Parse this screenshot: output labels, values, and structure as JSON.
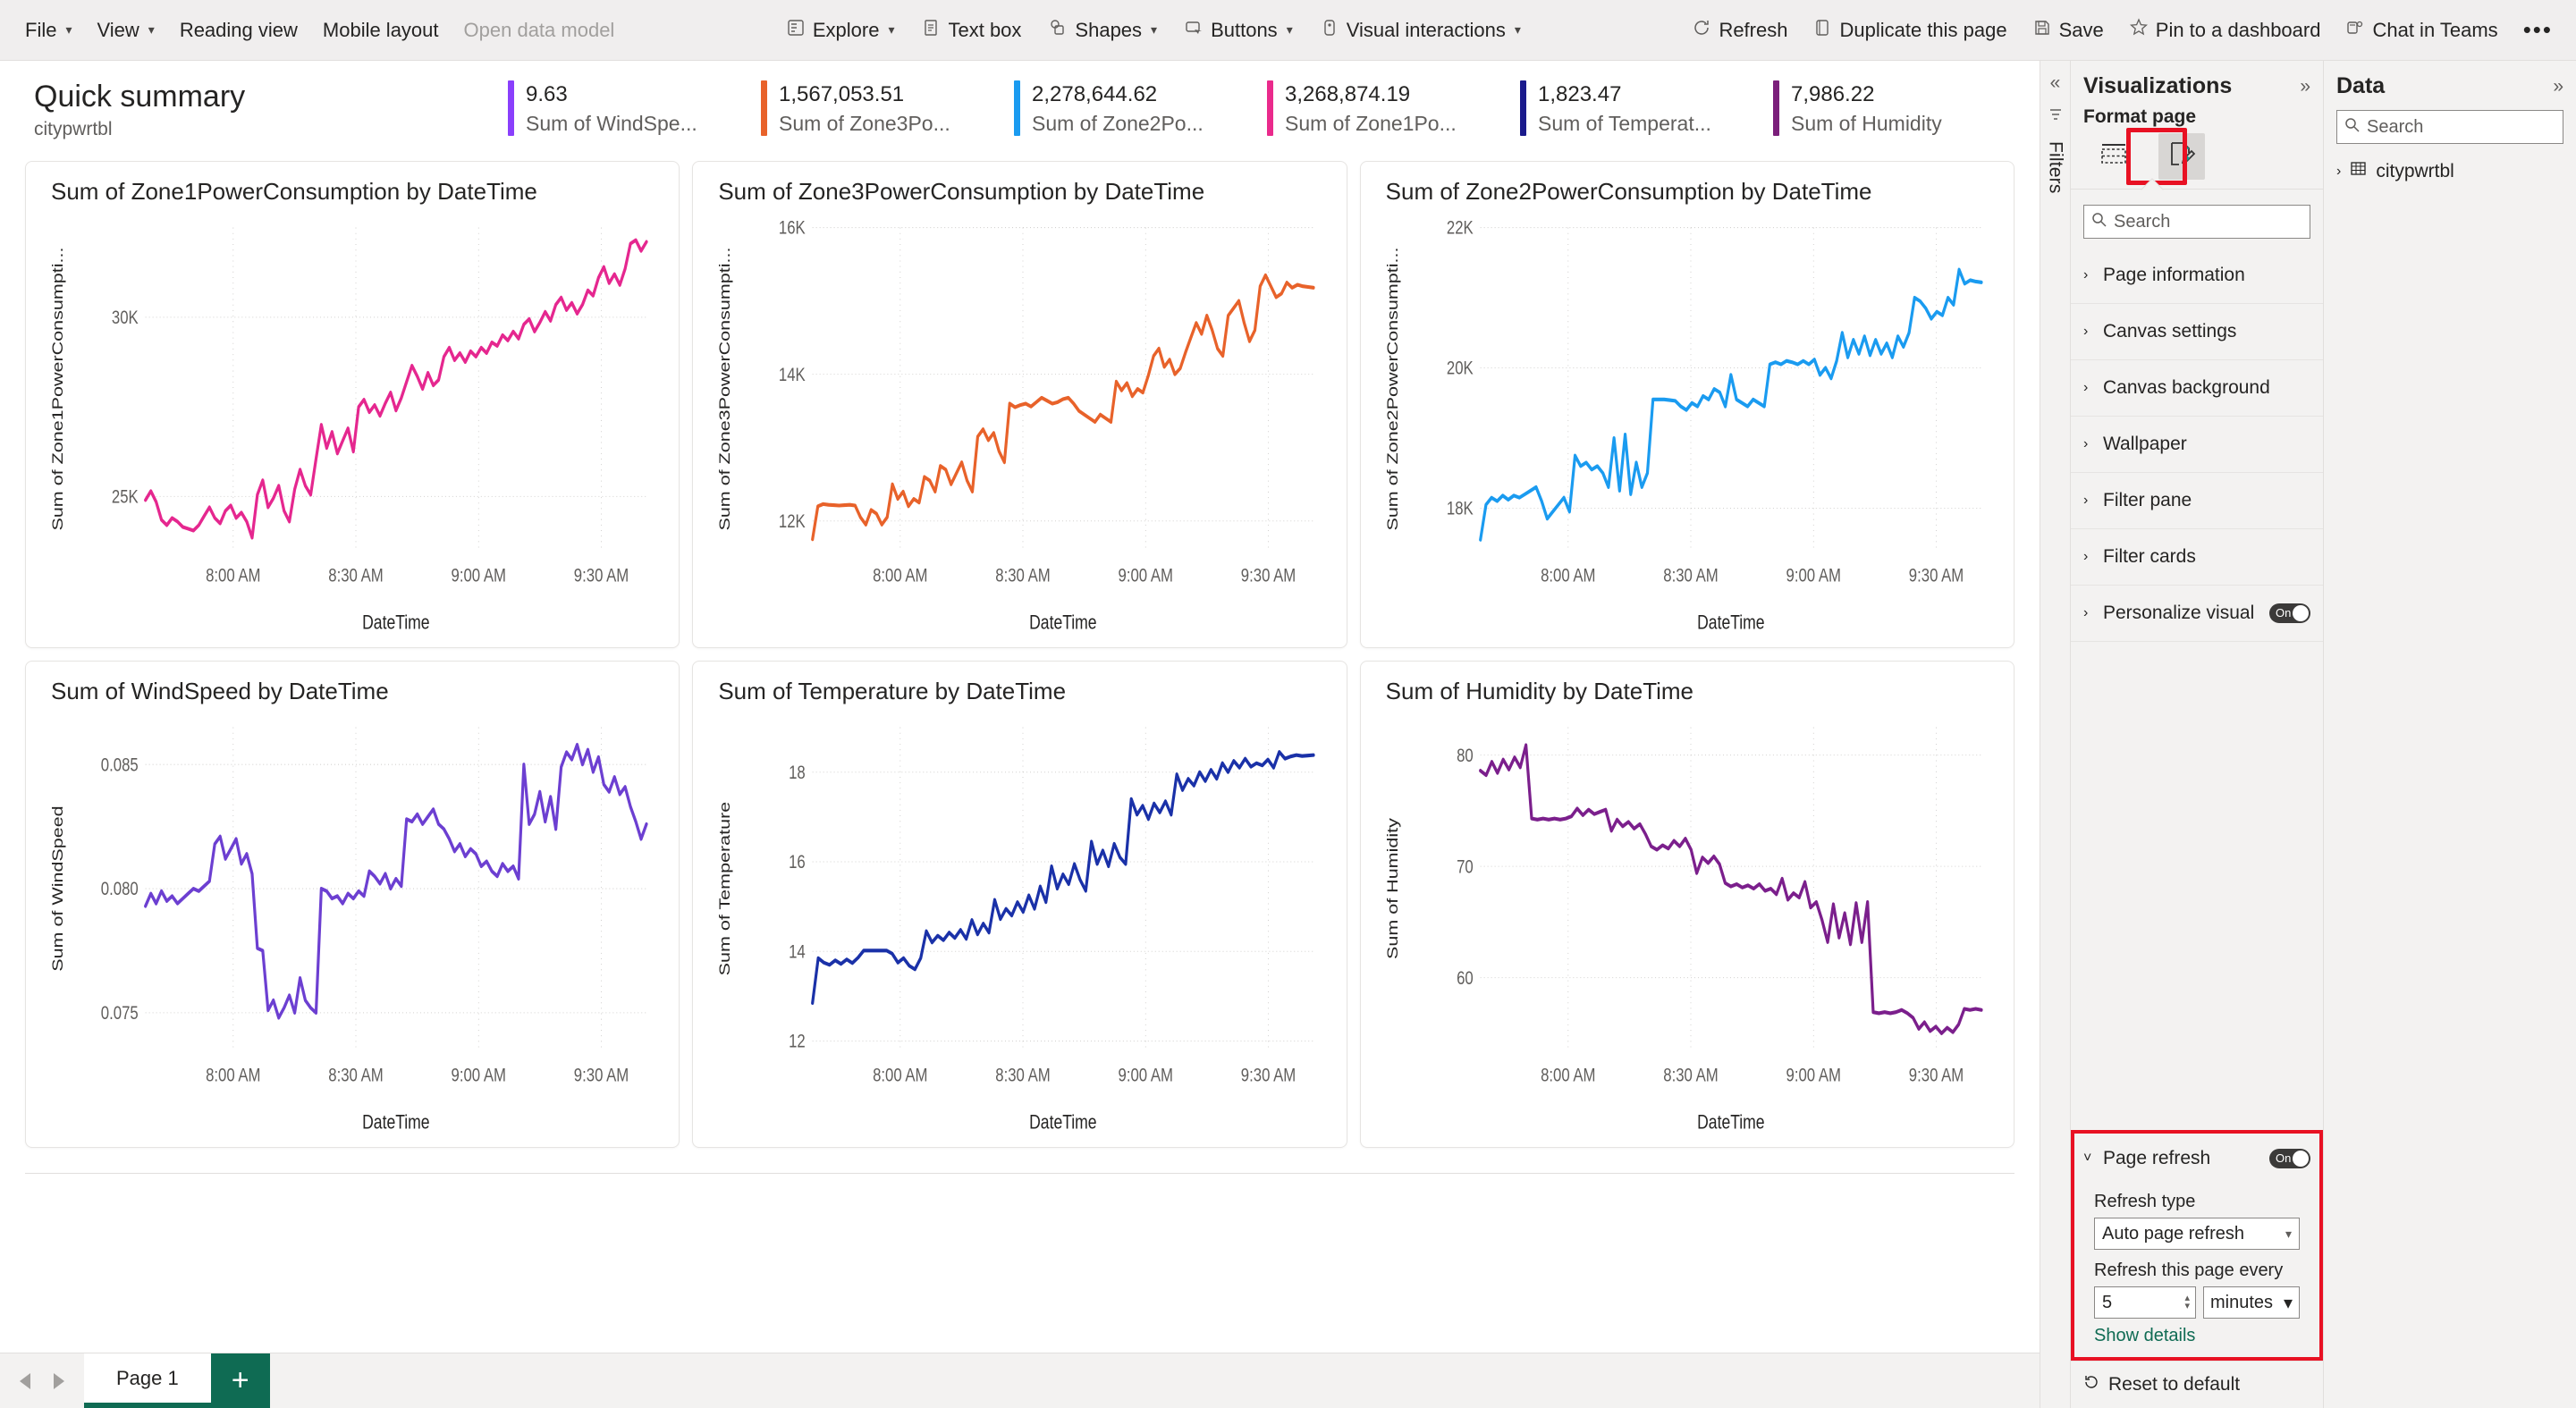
{
  "ribbon": {
    "left": [
      {
        "label": "File",
        "icon": "chevron-down-icon",
        "has_chevron": true,
        "dim": false
      },
      {
        "label": "View",
        "icon": "chevron-down-icon",
        "has_chevron": true,
        "dim": false
      },
      {
        "label": "Reading view",
        "icon": "",
        "has_chevron": false,
        "dim": false
      },
      {
        "label": "Mobile layout",
        "icon": "",
        "has_chevron": false,
        "dim": false
      },
      {
        "label": "Open data model",
        "icon": "",
        "has_chevron": false,
        "dim": true
      }
    ],
    "center": [
      {
        "label": "Explore",
        "icon": "explore-icon",
        "has_chevron": true
      },
      {
        "label": "Text box",
        "icon": "textbox-icon",
        "has_chevron": false
      },
      {
        "label": "Shapes",
        "icon": "shapes-icon",
        "has_chevron": true
      },
      {
        "label": "Buttons",
        "icon": "buttons-icon",
        "has_chevron": true
      },
      {
        "label": "Visual interactions",
        "icon": "visual-interactions-icon",
        "has_chevron": true
      }
    ],
    "right": [
      {
        "label": "Refresh",
        "icon": "refresh-icon"
      },
      {
        "label": "Duplicate this page",
        "icon": "duplicate-icon"
      },
      {
        "label": "Save",
        "icon": "save-icon"
      },
      {
        "label": "Pin to a dashboard",
        "icon": "pin-icon"
      },
      {
        "label": "Chat in Teams",
        "icon": "teams-icon"
      }
    ],
    "overflow_label": "•••"
  },
  "summary": {
    "title": "Quick summary",
    "subtitle": "citypwrtbl",
    "kpis": [
      {
        "value": "9.63",
        "label": "Sum of WindSpe...",
        "color": "#8a3ffc"
      },
      {
        "value": "1,567,053.51",
        "label": "Sum of Zone3Po...",
        "color": "#e8622a"
      },
      {
        "value": "2,278,644.62",
        "label": "Sum of Zone2Po...",
        "color": "#1a9bf0"
      },
      {
        "value": "3,268,874.19",
        "label": "Sum of Zone1Po...",
        "color": "#ea2a8c"
      },
      {
        "value": "1,823.47",
        "label": "Sum of Temperat...",
        "color": "#1a1a8c"
      },
      {
        "value": "7,986.22",
        "label": "Sum of Humidity",
        "color": "#7b1f7b"
      }
    ]
  },
  "chart_data": [
    {
      "type": "line",
      "title": "Sum of Zone1PowerConsumption by DateTime",
      "xlabel": "DateTime",
      "ylabel": "Sum of Zone1PowerConsumpti...",
      "color": "#e5278f",
      "xticks": [
        "8:00 AM",
        "8:30 AM",
        "9:00 AM",
        "9:30 AM"
      ],
      "yticks": [
        "25K",
        "30K"
      ],
      "ytick_values": [
        25000,
        30000
      ],
      "ylim": [
        23500,
        32500
      ],
      "values": [
        24900,
        25150,
        24850,
        24350,
        24200,
        24400,
        24300,
        24150,
        24100,
        24050,
        24200,
        24450,
        24700,
        24400,
        24250,
        24600,
        24750,
        24400,
        24550,
        24300,
        23850,
        25050,
        25450,
        24700,
        24950,
        25300,
        24600,
        24300,
        25200,
        25750,
        25300,
        25050,
        26050,
        27000,
        26350,
        26800,
        26200,
        26550,
        26900,
        26250,
        27500,
        27700,
        27350,
        27550,
        27250,
        27600,
        27900,
        27400,
        27750,
        28200,
        28650,
        28350,
        28000,
        28450,
        28100,
        28250,
        28900,
        29150,
        28800,
        29000,
        28750,
        29050,
        28900,
        29150,
        29000,
        29300,
        29200,
        29500,
        29350,
        29600,
        29400,
        29800,
        29950,
        29600,
        29850,
        30150,
        29900,
        30350,
        30550,
        30200,
        30400,
        30100,
        30350,
        30750,
        30600,
        31100,
        31400,
        30950,
        31200,
        30900,
        31350,
        32050,
        32150,
        31850,
        32100
      ]
    },
    {
      "type": "line",
      "title": "Sum of Zone3PowerConsumption by DateTime",
      "xlabel": "DateTime",
      "ylabel": "Sum of Zone3PowerConsumpti...",
      "color": "#e8622a",
      "xticks": [
        "8:00 AM",
        "8:30 AM",
        "9:00 AM",
        "9:30 AM"
      ],
      "yticks": [
        "12K",
        "14K",
        "16K"
      ],
      "ytick_values": [
        12000,
        14000,
        16000
      ],
      "ylim": [
        11600,
        16000
      ],
      "values": [
        11750,
        12200,
        12230,
        12220,
        12215,
        12210,
        12215,
        12220,
        12210,
        12050,
        11950,
        12150,
        12100,
        11950,
        12050,
        12500,
        12300,
        12400,
        12200,
        12300,
        12250,
        12600,
        12550,
        12400,
        12750,
        12700,
        12500,
        12650,
        12800,
        12550,
        12400,
        13150,
        13250,
        13100,
        13200,
        12950,
        12800,
        13600,
        13550,
        13580,
        13600,
        13560,
        13620,
        13680,
        13640,
        13600,
        13620,
        13660,
        13680,
        13600,
        13500,
        13450,
        13400,
        13350,
        13450,
        13400,
        13350,
        13900,
        13780,
        13880,
        13700,
        13800,
        13750,
        13980,
        14250,
        14350,
        14100,
        14200,
        14000,
        14080,
        14300,
        14500,
        14700,
        14550,
        14800,
        14600,
        14350,
        14250,
        14800,
        14900,
        15000,
        14700,
        14450,
        14600,
        15200,
        15350,
        15200,
        15050,
        15100,
        15250,
        15180,
        15220,
        15200,
        15190,
        15180
      ]
    },
    {
      "type": "line",
      "title": "Sum of Zone2PowerConsumption by DateTime",
      "xlabel": "DateTime",
      "ylabel": "Sum of Zone2PowerConsumpti...",
      "color": "#1a9bf0",
      "xticks": [
        "8:00 AM",
        "8:30 AM",
        "9:00 AM",
        "9:30 AM"
      ],
      "yticks": [
        "18K",
        "20K",
        "22K"
      ],
      "ytick_values": [
        18000,
        20000,
        22000
      ],
      "ylim": [
        17400,
        22000
      ],
      "values": [
        17550,
        18050,
        18150,
        18100,
        18180,
        18120,
        18180,
        18150,
        18200,
        18250,
        18300,
        18100,
        17850,
        17950,
        18050,
        18150,
        17950,
        18750,
        18600,
        18650,
        18550,
        18600,
        18500,
        18300,
        19000,
        18250,
        19050,
        18200,
        18650,
        18300,
        18500,
        19550,
        19550,
        19550,
        19540,
        19530,
        19450,
        19400,
        19500,
        19450,
        19600,
        19550,
        19700,
        19650,
        19450,
        19900,
        19550,
        19500,
        19450,
        19550,
        19500,
        19450,
        20050,
        20080,
        20050,
        20100,
        20080,
        20050,
        20100,
        20050,
        20120,
        19900,
        20000,
        19850,
        20100,
        20500,
        20150,
        20400,
        20200,
        20450,
        20180,
        20400,
        20200,
        20350,
        20150,
        20450,
        20300,
        20500,
        21000,
        20950,
        20850,
        20700,
        20800,
        20750,
        21000,
        20900,
        21400,
        21200,
        21250,
        21230,
        21220
      ]
    },
    {
      "type": "line",
      "title": "Sum of WindSpeed by DateTime",
      "xlabel": "DateTime",
      "ylabel": "Sum of WindSpeed",
      "color": "#6c3fd1",
      "xticks": [
        "8:00 AM",
        "8:30 AM",
        "9:00 AM",
        "9:30 AM"
      ],
      "yticks": [
        "0.075",
        "0.080",
        "0.085"
      ],
      "ytick_values": [
        0.075,
        0.08,
        0.085
      ],
      "ylim": [
        0.0735,
        0.0865
      ],
      "values": [
        0.0793,
        0.0798,
        0.0794,
        0.0799,
        0.0795,
        0.0797,
        0.0794,
        0.0796,
        0.0798,
        0.08,
        0.0799,
        0.0801,
        0.0803,
        0.0818,
        0.0821,
        0.0812,
        0.0816,
        0.082,
        0.081,
        0.0814,
        0.0806,
        0.0776,
        0.0775,
        0.0751,
        0.0755,
        0.0748,
        0.0752,
        0.0757,
        0.075,
        0.0764,
        0.0755,
        0.0752,
        0.075,
        0.08,
        0.0799,
        0.0796,
        0.0797,
        0.0794,
        0.0798,
        0.0796,
        0.0799,
        0.0797,
        0.0807,
        0.0805,
        0.0802,
        0.0806,
        0.08,
        0.0804,
        0.0801,
        0.0828,
        0.0827,
        0.083,
        0.0826,
        0.0829,
        0.0832,
        0.0826,
        0.0824,
        0.082,
        0.0815,
        0.0818,
        0.0813,
        0.0816,
        0.0814,
        0.0809,
        0.0811,
        0.0807,
        0.0805,
        0.081,
        0.0807,
        0.0809,
        0.0804,
        0.085,
        0.0826,
        0.083,
        0.0839,
        0.0827,
        0.0837,
        0.0824,
        0.0849,
        0.0855,
        0.0852,
        0.0858,
        0.085,
        0.0856,
        0.0847,
        0.0853,
        0.0842,
        0.0839,
        0.0845,
        0.0838,
        0.0841,
        0.0833,
        0.0827,
        0.082,
        0.0826
      ]
    },
    {
      "type": "line",
      "title": "Sum of Temperature by DateTime",
      "xlabel": "DateTime",
      "ylabel": "Sum of Temperature",
      "color": "#1a31a8",
      "xticks": [
        "8:00 AM",
        "8:30 AM",
        "9:00 AM",
        "9:30 AM"
      ],
      "yticks": [
        "12",
        "14",
        "16",
        "18"
      ],
      "ytick_values": [
        12,
        14,
        16,
        18
      ],
      "ylim": [
        11.8,
        19.0
      ],
      "values": [
        12.85,
        13.85,
        13.75,
        13.7,
        13.8,
        13.72,
        13.82,
        13.74,
        13.86,
        14.02,
        14.02,
        14.02,
        14.02,
        14.02,
        13.95,
        13.75,
        13.85,
        13.68,
        13.6,
        13.85,
        14.45,
        14.2,
        14.35,
        14.25,
        14.42,
        14.3,
        14.48,
        14.28,
        14.7,
        14.38,
        14.62,
        14.42,
        15.15,
        14.72,
        14.95,
        14.8,
        15.1,
        14.88,
        15.25,
        14.95,
        15.45,
        15.1,
        15.9,
        15.4,
        15.72,
        15.5,
        15.95,
        15.6,
        15.35,
        16.45,
        15.95,
        16.25,
        15.9,
        16.4,
        16.1,
        15.95,
        17.4,
        17.05,
        17.25,
        16.95,
        17.3,
        17.1,
        17.35,
        17.05,
        17.95,
        17.6,
        17.85,
        17.7,
        18.0,
        17.8,
        18.05,
        17.85,
        18.2,
        18.0,
        18.25,
        18.1,
        18.3,
        18.12,
        18.2,
        18.15,
        18.28,
        18.1,
        18.45,
        18.3,
        18.35,
        18.38,
        18.36,
        18.37,
        18.38
      ]
    },
    {
      "type": "line",
      "title": "Sum of Humidity by DateTime",
      "xlabel": "DateTime",
      "ylabel": "Sum of Humidity",
      "color": "#7b1f8c",
      "xticks": [
        "8:00 AM",
        "8:30 AM",
        "9:00 AM",
        "9:30 AM"
      ],
      "yticks": [
        "60",
        "70",
        "80"
      ],
      "ytick_values": [
        60,
        70,
        80
      ],
      "ylim": [
        53.5,
        82.5
      ],
      "values": [
        78.6,
        78.2,
        79.4,
        78.4,
        79.6,
        78.7,
        79.8,
        78.9,
        80.9,
        74.3,
        74.2,
        74.3,
        74.2,
        74.3,
        74.2,
        74.3,
        74.5,
        75.2,
        74.6,
        75.1,
        74.7,
        74.9,
        75.1,
        73.2,
        74.2,
        73.6,
        74.0,
        73.4,
        73.8,
        72.9,
        71.8,
        71.5,
        71.9,
        71.6,
        72.3,
        71.8,
        72.5,
        71.5,
        69.4,
        70.8,
        70.3,
        70.9,
        70.2,
        68.5,
        68.2,
        68.4,
        68.1,
        68.3,
        68.0,
        68.4,
        67.8,
        68.0,
        67.5,
        68.9,
        67.0,
        67.6,
        67.2,
        68.6,
        66.3,
        66.8,
        65.2,
        63.2,
        66.6,
        63.6,
        65.8,
        63.0,
        66.7,
        63.2,
        66.8,
        56.9,
        56.8,
        56.9,
        56.8,
        56.9,
        57.1,
        56.8,
        56.4,
        55.4,
        56.0,
        55.2,
        55.6,
        55.0,
        55.5,
        55.1,
        55.8,
        57.2,
        57.1,
        57.2,
        57.1
      ]
    }
  ],
  "tabbar": {
    "page_label": "Page 1",
    "add_label": "+"
  },
  "rail": {
    "collapse": "«",
    "filters_label": "Filters"
  },
  "visualizations": {
    "title": "Visualizations",
    "expand": "»",
    "format_label": "Format page",
    "search_placeholder": "Search",
    "accordion": [
      {
        "label": "Page information",
        "expanded": false,
        "toggle": null
      },
      {
        "label": "Canvas settings",
        "expanded": false,
        "toggle": null
      },
      {
        "label": "Canvas background",
        "expanded": false,
        "toggle": null
      },
      {
        "label": "Wallpaper",
        "expanded": false,
        "toggle": null
      },
      {
        "label": "Filter pane",
        "expanded": false,
        "toggle": null
      },
      {
        "label": "Filter cards",
        "expanded": false,
        "toggle": null
      },
      {
        "label": "Personalize visual",
        "expanded": false,
        "toggle": "On"
      }
    ],
    "page_refresh": {
      "label": "Page refresh",
      "toggle": "On",
      "refresh_type_label": "Refresh type",
      "refresh_type_value": "Auto page refresh",
      "interval_label": "Refresh this page every",
      "interval_value": "5",
      "unit_value": "minutes",
      "details_link": "Show details"
    },
    "reset_label": "Reset to default"
  },
  "data_pane": {
    "title": "Data",
    "expand": "»",
    "search_placeholder": "Search",
    "table_name": "citypwrtbl"
  }
}
